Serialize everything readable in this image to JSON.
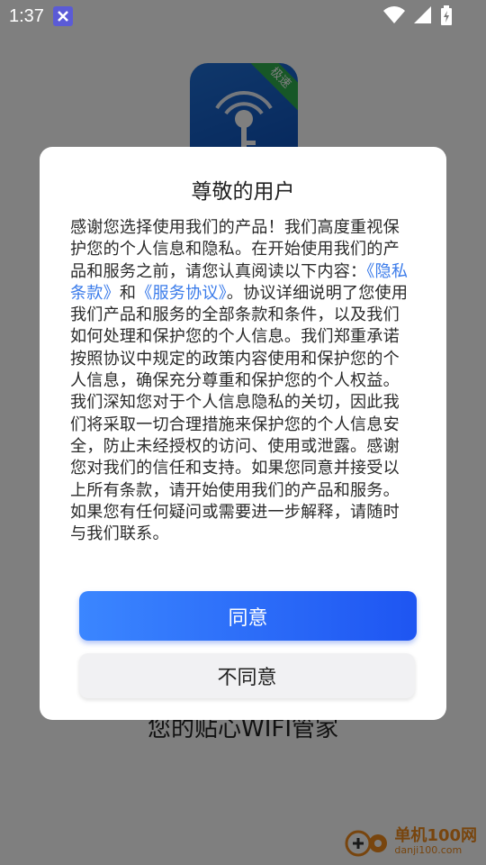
{
  "status_bar": {
    "time": "1:37",
    "icons": [
      "app-notification-icon",
      "wifi-icon",
      "signal-icon",
      "battery-charging-icon"
    ]
  },
  "app": {
    "logo_badge": "极速",
    "tagline": "您的贴心WIFI管家"
  },
  "dialog": {
    "title": "尊敬的用户",
    "body_part1": "感谢您选择使用我们的产品！我们高度重视保护您的个人信息和隐私。在开始使用我们的产品和服务之前，请您认真阅读以下内容：",
    "privacy_link": "《隐私条款》",
    "and_text": "和",
    "service_link": "《服务协议》",
    "body_part2": "。协议详细说明了您使用我们产品和服务的全部条款和条件，以及我们如何处理和保护您的个人信息。我们郑重承诺按照协议中规定的政策内容使用和保护您的个人信息，确保充分尊重和保护您的个人权益。我们深知您对于个人信息隐私的关切，因此我们将采取一切合理措施来保护您的个人信息安全，防止未经授权的访问、使用或泄露。感谢您对我们的信任和支持。如果您同意并接受以上所有条款，请开始使用我们的产品和服务。如果您有任何疑问或需要进一步解释，请随时与我们联系。",
    "agree_label": "同意",
    "disagree_label": "不同意"
  },
  "watermark": {
    "name": "单机100网",
    "url": "danji100.com"
  },
  "colors": {
    "link": "#3a7bea",
    "agree_gradient_start": "#3b86ff",
    "agree_gradient_end": "#1e55f2",
    "logo_blue": "#1f6fd6",
    "badge_green": "#2fae4f"
  }
}
